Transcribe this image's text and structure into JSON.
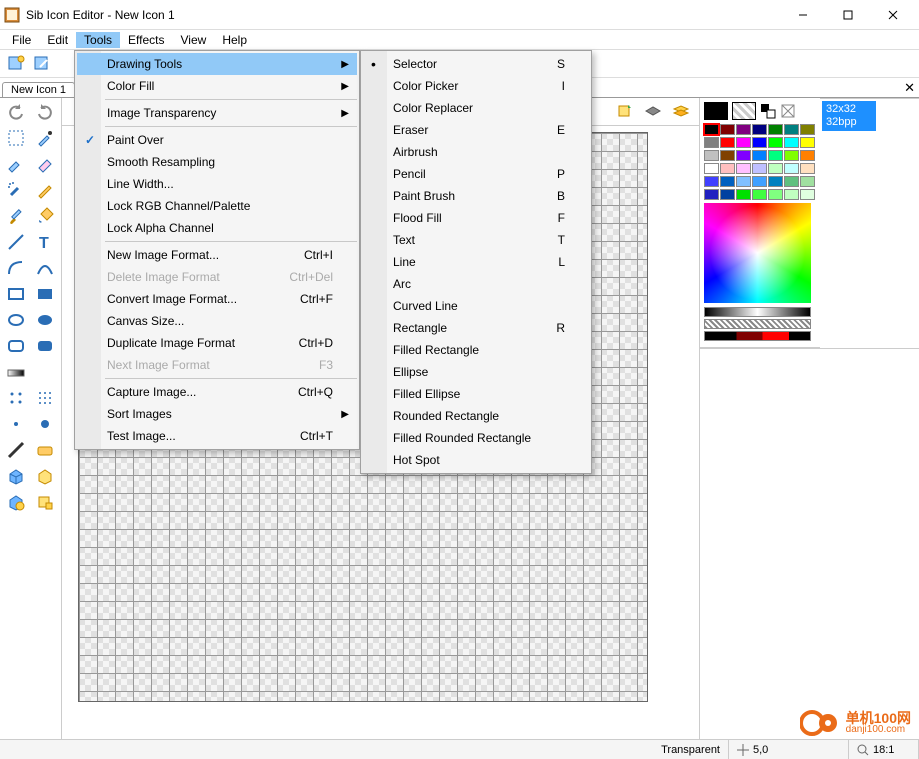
{
  "title": "Sib Icon Editor - New Icon 1",
  "menubar": [
    "File",
    "Edit",
    "Tools",
    "Effects",
    "View",
    "Help"
  ],
  "active_menu_index": 2,
  "tab_label": "New Icon 1",
  "tools_menu": [
    {
      "label": "Drawing Tools",
      "arrow": true,
      "highlight": true
    },
    {
      "label": "Color Fill",
      "arrow": true
    },
    {
      "sep": true
    },
    {
      "label": "Image Transparency",
      "arrow": true
    },
    {
      "sep": true
    },
    {
      "label": "Paint Over",
      "check": true
    },
    {
      "label": "Smooth Resampling"
    },
    {
      "label": "Line Width..."
    },
    {
      "label": "Lock RGB Channel/Palette"
    },
    {
      "label": "Lock Alpha Channel"
    },
    {
      "sep": true
    },
    {
      "label": "New Image Format...",
      "shortcut": "Ctrl+I"
    },
    {
      "label": "Delete Image Format",
      "shortcut": "Ctrl+Del",
      "disabled": true
    },
    {
      "label": "Convert Image Format...",
      "shortcut": "Ctrl+F"
    },
    {
      "label": "Canvas Size..."
    },
    {
      "label": "Duplicate Image Format",
      "shortcut": "Ctrl+D"
    },
    {
      "label": "Next Image Format",
      "shortcut": "F3",
      "disabled": true
    },
    {
      "sep": true
    },
    {
      "label": "Capture Image...",
      "shortcut": "Ctrl+Q"
    },
    {
      "label": "Sort Images",
      "arrow": true
    },
    {
      "label": "Test Image...",
      "shortcut": "Ctrl+T"
    }
  ],
  "drawing_submenu": [
    {
      "label": "Selector",
      "shortcut": "S",
      "bullet": true
    },
    {
      "label": "Color Picker",
      "shortcut": "I"
    },
    {
      "label": "Color Replacer"
    },
    {
      "label": "Eraser",
      "shortcut": "E"
    },
    {
      "label": "Airbrush"
    },
    {
      "label": "Pencil",
      "shortcut": "P"
    },
    {
      "label": "Paint Brush",
      "shortcut": "B"
    },
    {
      "label": "Flood Fill",
      "shortcut": "F"
    },
    {
      "label": "Text",
      "shortcut": "T"
    },
    {
      "label": "Line",
      "shortcut": "L"
    },
    {
      "label": "Arc"
    },
    {
      "label": "Curved Line"
    },
    {
      "label": "Rectangle",
      "shortcut": "R"
    },
    {
      "label": "Filled Rectangle"
    },
    {
      "label": "Ellipse"
    },
    {
      "label": "Filled Ellipse"
    },
    {
      "label": "Rounded Rectangle"
    },
    {
      "label": "Filled Rounded Rectangle"
    },
    {
      "label": "Hot Spot"
    }
  ],
  "palette_row1": [
    "#000000",
    "#404040",
    "#000080",
    "#008000",
    "#808000"
  ],
  "palette_rows": [
    [
      "#000000",
      "#800000",
      "#800080",
      "#000080",
      "#008000",
      "#008080",
      "#808000"
    ],
    [
      "#808080",
      "#ff0000",
      "#ff00ff",
      "#0000ff",
      "#00ff00",
      "#00ffff",
      "#ffff00"
    ],
    [
      "#c0c0c0",
      "#804000",
      "#8000ff",
      "#0080ff",
      "#00ff80",
      "#80ff00",
      "#ff8000"
    ],
    [
      "#ffffff",
      "#ffc0c0",
      "#ffc0ff",
      "#c0c0ff",
      "#c0ffc0",
      "#c0ffff",
      "#ffe0c0"
    ],
    [
      "#4040ff",
      "#0060c0",
      "#80c0ff",
      "#40a0ff",
      "#0080c0",
      "#60c080",
      "#a0e0a0"
    ],
    [
      "#2020c0",
      "#0040a0",
      "#00e000",
      "#40ff40",
      "#80ff80",
      "#c0ffc0",
      "#e0ffe0"
    ]
  ],
  "selected_palette": [
    0,
    0
  ],
  "size_item": {
    "line1": "32x32",
    "line2": "32bpp"
  },
  "status": {
    "transparent": "Transparent",
    "coords": "5,0",
    "zoom": "18:1"
  },
  "watermark": {
    "line1": "单机100网",
    "line2": "danji100.com"
  }
}
